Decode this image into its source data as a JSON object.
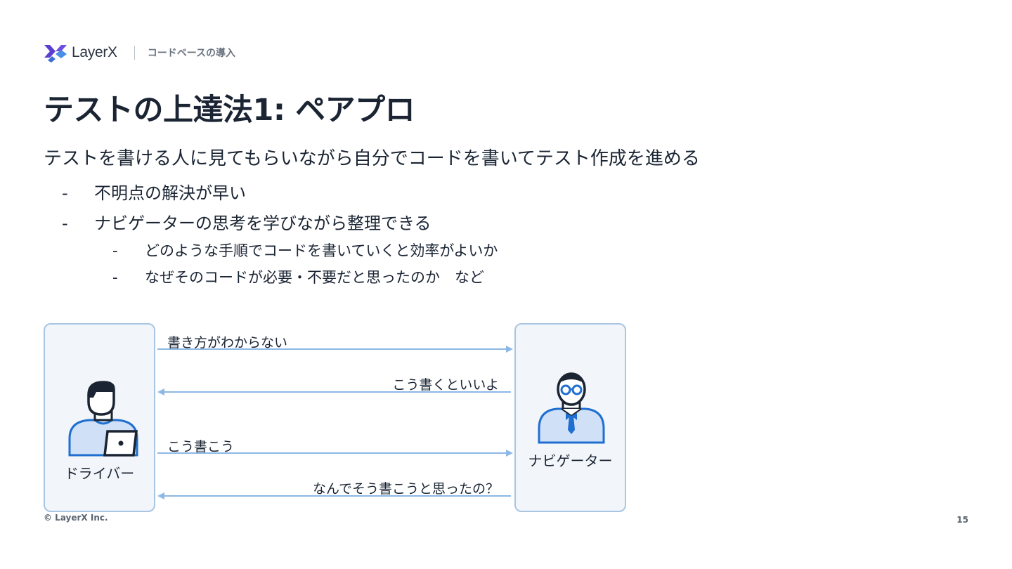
{
  "header": {
    "logo_text": "LayerX",
    "section": "コードベースの導入"
  },
  "title": "テストの上達法1: ペアプロ",
  "body": {
    "lead": "テストを書ける人に見てもらいながら自分でコードを書いてテスト作成を進める",
    "bullets": [
      {
        "marker": "-",
        "text": "不明点の解決が早い"
      },
      {
        "marker": "-",
        "text": "ナビゲーターの思考を学びながら整理できる"
      }
    ],
    "sub_bullets": [
      {
        "marker": "-",
        "text": "どのような手順でコードを書いていくと効率がよいか"
      },
      {
        "marker": "-",
        "text": "なぜそのコードが必要・不要だと思ったのか　など"
      }
    ]
  },
  "diagram": {
    "driver_label": "ドライバー",
    "navigator_label": "ナビゲーター",
    "messages": [
      {
        "text": "書き方がわからない",
        "direction": "to-navigator"
      },
      {
        "text": "こう書くといいよ",
        "direction": "to-driver"
      },
      {
        "text": "こう書こう",
        "direction": "to-navigator"
      },
      {
        "text": "なんでそう書こうと思ったの？",
        "direction": "to-driver"
      }
    ]
  },
  "footer": {
    "copyright": "© LayerX Inc.",
    "page": "15"
  },
  "colors": {
    "text": "#1a2433",
    "logo_purple": "#5b3fd1",
    "logo_blue": "#4a8ee8",
    "box_border": "#a8c6e4",
    "box_fill": "#f2f5f9",
    "arrow": "#8db8e6",
    "person_fill": "#cfe0f7",
    "person_stroke": "#1f6fd1"
  }
}
